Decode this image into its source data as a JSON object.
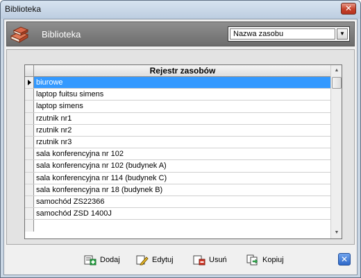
{
  "window": {
    "title": "Biblioteka",
    "close_glyph": "✕"
  },
  "header": {
    "title": "Biblioteka",
    "icon": "books-icon"
  },
  "filter": {
    "selected": "Nazwa zasobu",
    "arrow_glyph": "▼"
  },
  "grid": {
    "column_title": "Rejestr zasobów",
    "rows": [
      "biurowe",
      "laptop fuitsu simens",
      "laptop simens",
      "rzutnik nr1",
      "rzutnik nr2",
      "rzutnik nr3",
      "sala konferencyjna nr 102",
      "sala konferencyjna nr 102 (budynek A)",
      "sala konferencyjna nr 114 (budynek C)",
      "sala konferencyjna nr 18 (budynek B)",
      "samochód ZS22366",
      "samochód ZSD 1400J"
    ],
    "selected_index": 0,
    "scroll_up_glyph": "▲",
    "scroll_down_glyph": "▼"
  },
  "toolbar": {
    "add": "Dodaj",
    "edit": "Edytuj",
    "delete": "Usuń",
    "copy": "Kopiuj",
    "exit_glyph": "✕"
  },
  "colors": {
    "selection": "#3399ff",
    "header_panel": "#7a7a7a",
    "titlebar": "#c9d6e4"
  }
}
